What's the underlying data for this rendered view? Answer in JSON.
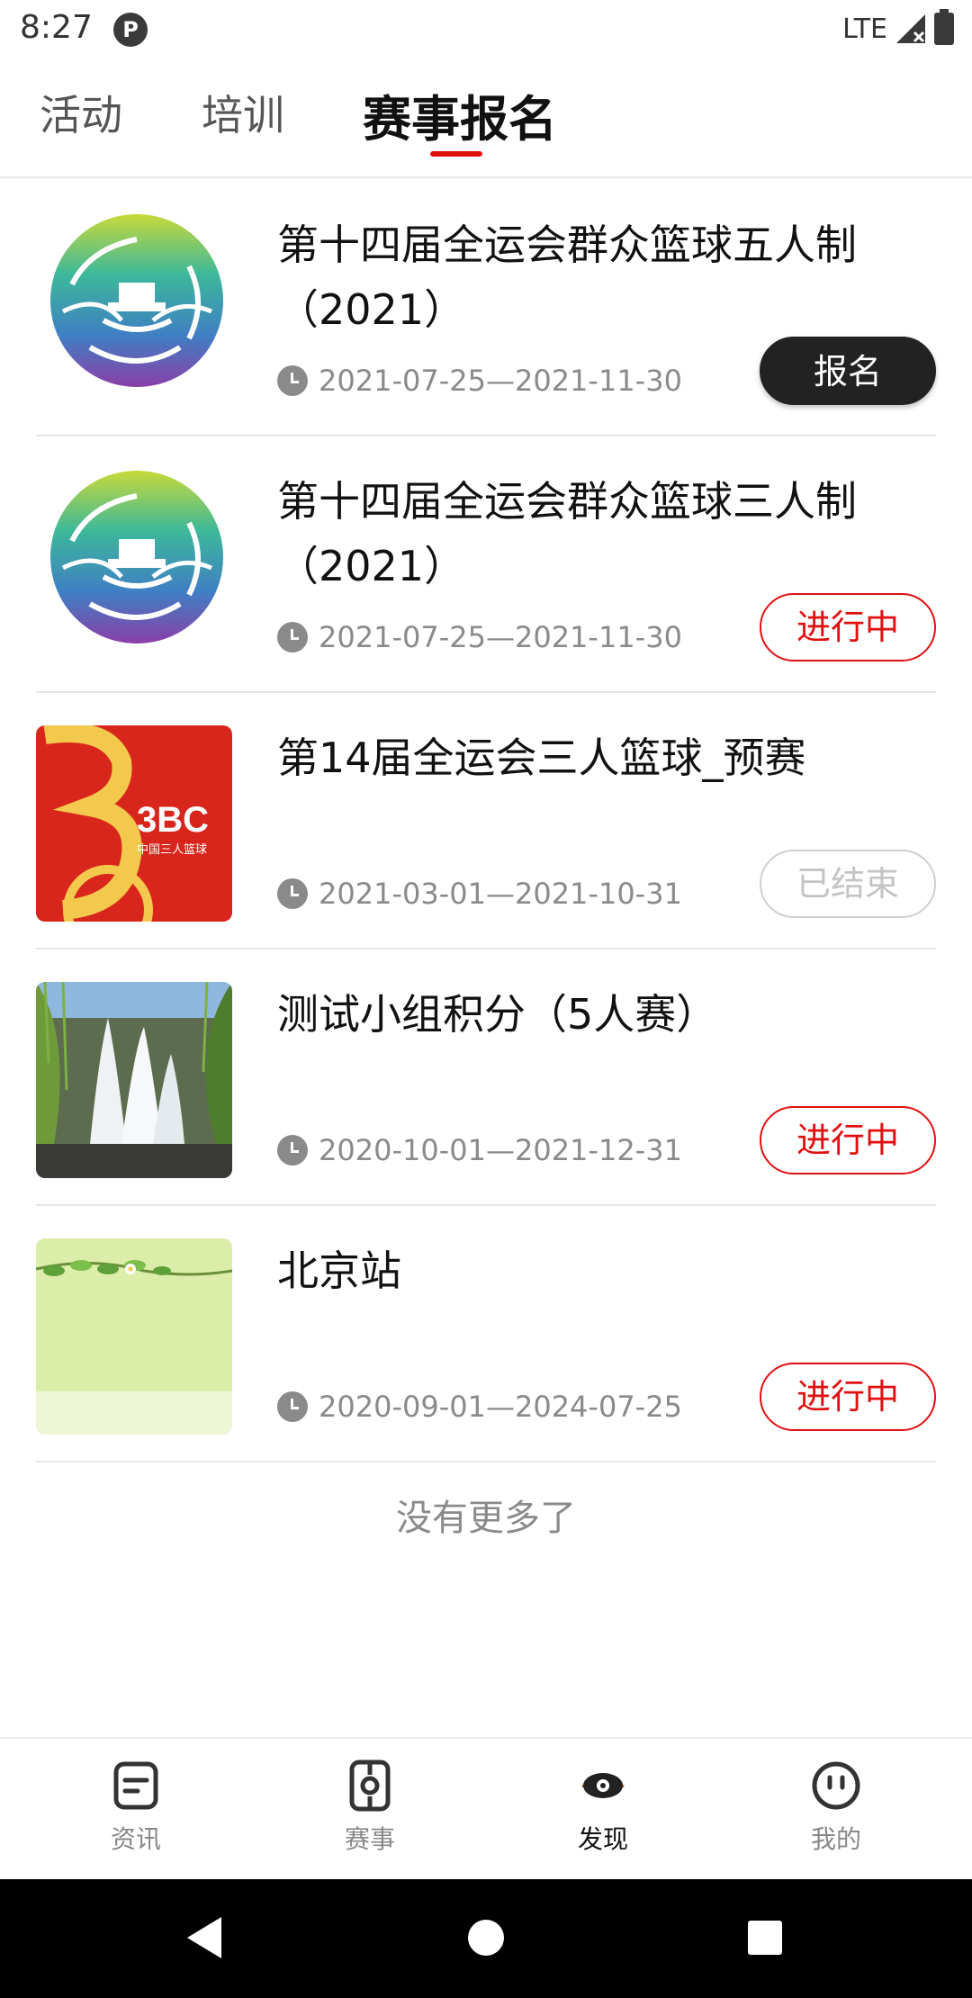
{
  "status_bar": {
    "time": "8:27",
    "network": "LTE"
  },
  "tabs": [
    {
      "label": "活动",
      "active": false
    },
    {
      "label": "培训",
      "active": false
    },
    {
      "label": "赛事报名",
      "active": true
    }
  ],
  "events": [
    {
      "title": "第十四届全运会群众篮球五人制（2021）",
      "dates": "2021-07-25—2021-11-30",
      "status": "报名",
      "status_type": "register",
      "thumb_icon": "games-emblem-icon"
    },
    {
      "title": "第十四届全运会群众篮球三人制（2021）",
      "dates": "2021-07-25—2021-11-30",
      "status": "进行中",
      "status_type": "ongoing",
      "thumb_icon": "games-emblem-icon"
    },
    {
      "title": "第14届全运会三人篮球_预赛",
      "dates": "2021-03-01—2021-10-31",
      "status": "已结束",
      "status_type": "ended",
      "thumb_icon": "3bc-logo-icon",
      "thumb_text": "3BC",
      "thumb_subtext": "中国三人篮球"
    },
    {
      "title": "测试小组积分（5人赛）",
      "dates": "2020-10-01—2021-12-31",
      "status": "进行中",
      "status_type": "ongoing",
      "thumb_icon": "fountain-photo-icon"
    },
    {
      "title": "北京站",
      "dates": "2020-09-01—2024-07-25",
      "status": "进行中",
      "status_type": "ongoing",
      "thumb_icon": "leaf-photo-icon"
    }
  ],
  "no_more_text": "没有更多了",
  "bottom_nav": [
    {
      "label": "资讯",
      "icon": "news-icon",
      "active": false
    },
    {
      "label": "赛事",
      "icon": "match-icon",
      "active": false
    },
    {
      "label": "发现",
      "icon": "discover-icon",
      "active": true
    },
    {
      "label": "我的",
      "icon": "profile-icon",
      "active": false
    }
  ],
  "colors": {
    "accent": "#e01010",
    "ended": "#c4c4c4",
    "register_bg": "#222222"
  }
}
